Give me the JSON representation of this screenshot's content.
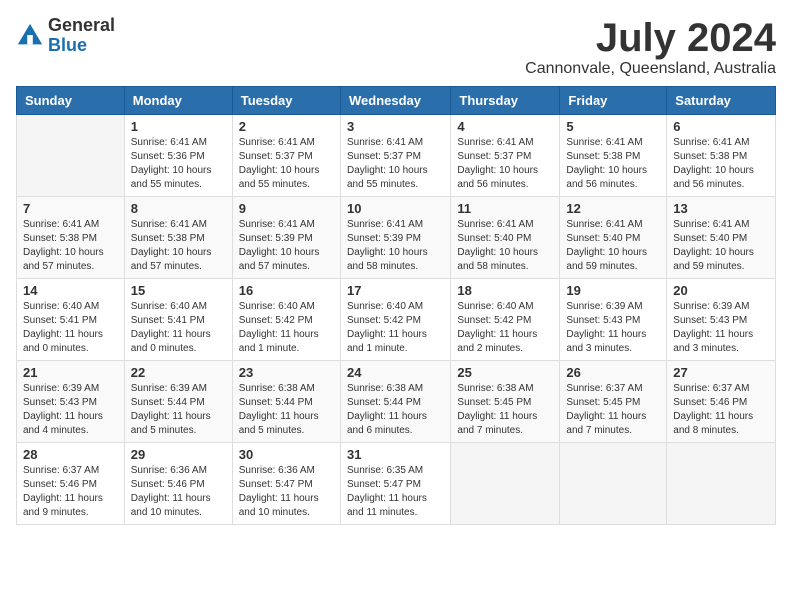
{
  "logo": {
    "general": "General",
    "blue": "Blue"
  },
  "title": "July 2024",
  "location": "Cannonvale, Queensland, Australia",
  "weekdays": [
    "Sunday",
    "Monday",
    "Tuesday",
    "Wednesday",
    "Thursday",
    "Friday",
    "Saturday"
  ],
  "weeks": [
    [
      {
        "day": "",
        "sunrise": "",
        "sunset": "",
        "daylight": ""
      },
      {
        "day": "1",
        "sunrise": "Sunrise: 6:41 AM",
        "sunset": "Sunset: 5:36 PM",
        "daylight": "Daylight: 10 hours and 55 minutes."
      },
      {
        "day": "2",
        "sunrise": "Sunrise: 6:41 AM",
        "sunset": "Sunset: 5:37 PM",
        "daylight": "Daylight: 10 hours and 55 minutes."
      },
      {
        "day": "3",
        "sunrise": "Sunrise: 6:41 AM",
        "sunset": "Sunset: 5:37 PM",
        "daylight": "Daylight: 10 hours and 55 minutes."
      },
      {
        "day": "4",
        "sunrise": "Sunrise: 6:41 AM",
        "sunset": "Sunset: 5:37 PM",
        "daylight": "Daylight: 10 hours and 56 minutes."
      },
      {
        "day": "5",
        "sunrise": "Sunrise: 6:41 AM",
        "sunset": "Sunset: 5:38 PM",
        "daylight": "Daylight: 10 hours and 56 minutes."
      },
      {
        "day": "6",
        "sunrise": "Sunrise: 6:41 AM",
        "sunset": "Sunset: 5:38 PM",
        "daylight": "Daylight: 10 hours and 56 minutes."
      }
    ],
    [
      {
        "day": "7",
        "sunrise": "Sunrise: 6:41 AM",
        "sunset": "Sunset: 5:38 PM",
        "daylight": "Daylight: 10 hours and 57 minutes."
      },
      {
        "day": "8",
        "sunrise": "Sunrise: 6:41 AM",
        "sunset": "Sunset: 5:38 PM",
        "daylight": "Daylight: 10 hours and 57 minutes."
      },
      {
        "day": "9",
        "sunrise": "Sunrise: 6:41 AM",
        "sunset": "Sunset: 5:39 PM",
        "daylight": "Daylight: 10 hours and 57 minutes."
      },
      {
        "day": "10",
        "sunrise": "Sunrise: 6:41 AM",
        "sunset": "Sunset: 5:39 PM",
        "daylight": "Daylight: 10 hours and 58 minutes."
      },
      {
        "day": "11",
        "sunrise": "Sunrise: 6:41 AM",
        "sunset": "Sunset: 5:40 PM",
        "daylight": "Daylight: 10 hours and 58 minutes."
      },
      {
        "day": "12",
        "sunrise": "Sunrise: 6:41 AM",
        "sunset": "Sunset: 5:40 PM",
        "daylight": "Daylight: 10 hours and 59 minutes."
      },
      {
        "day": "13",
        "sunrise": "Sunrise: 6:41 AM",
        "sunset": "Sunset: 5:40 PM",
        "daylight": "Daylight: 10 hours and 59 minutes."
      }
    ],
    [
      {
        "day": "14",
        "sunrise": "Sunrise: 6:40 AM",
        "sunset": "Sunset: 5:41 PM",
        "daylight": "Daylight: 11 hours and 0 minutes."
      },
      {
        "day": "15",
        "sunrise": "Sunrise: 6:40 AM",
        "sunset": "Sunset: 5:41 PM",
        "daylight": "Daylight: 11 hours and 0 minutes."
      },
      {
        "day": "16",
        "sunrise": "Sunrise: 6:40 AM",
        "sunset": "Sunset: 5:42 PM",
        "daylight": "Daylight: 11 hours and 1 minute."
      },
      {
        "day": "17",
        "sunrise": "Sunrise: 6:40 AM",
        "sunset": "Sunset: 5:42 PM",
        "daylight": "Daylight: 11 hours and 1 minute."
      },
      {
        "day": "18",
        "sunrise": "Sunrise: 6:40 AM",
        "sunset": "Sunset: 5:42 PM",
        "daylight": "Daylight: 11 hours and 2 minutes."
      },
      {
        "day": "19",
        "sunrise": "Sunrise: 6:39 AM",
        "sunset": "Sunset: 5:43 PM",
        "daylight": "Daylight: 11 hours and 3 minutes."
      },
      {
        "day": "20",
        "sunrise": "Sunrise: 6:39 AM",
        "sunset": "Sunset: 5:43 PM",
        "daylight": "Daylight: 11 hours and 3 minutes."
      }
    ],
    [
      {
        "day": "21",
        "sunrise": "Sunrise: 6:39 AM",
        "sunset": "Sunset: 5:43 PM",
        "daylight": "Daylight: 11 hours and 4 minutes."
      },
      {
        "day": "22",
        "sunrise": "Sunrise: 6:39 AM",
        "sunset": "Sunset: 5:44 PM",
        "daylight": "Daylight: 11 hours and 5 minutes."
      },
      {
        "day": "23",
        "sunrise": "Sunrise: 6:38 AM",
        "sunset": "Sunset: 5:44 PM",
        "daylight": "Daylight: 11 hours and 5 minutes."
      },
      {
        "day": "24",
        "sunrise": "Sunrise: 6:38 AM",
        "sunset": "Sunset: 5:44 PM",
        "daylight": "Daylight: 11 hours and 6 minutes."
      },
      {
        "day": "25",
        "sunrise": "Sunrise: 6:38 AM",
        "sunset": "Sunset: 5:45 PM",
        "daylight": "Daylight: 11 hours and 7 minutes."
      },
      {
        "day": "26",
        "sunrise": "Sunrise: 6:37 AM",
        "sunset": "Sunset: 5:45 PM",
        "daylight": "Daylight: 11 hours and 7 minutes."
      },
      {
        "day": "27",
        "sunrise": "Sunrise: 6:37 AM",
        "sunset": "Sunset: 5:46 PM",
        "daylight": "Daylight: 11 hours and 8 minutes."
      }
    ],
    [
      {
        "day": "28",
        "sunrise": "Sunrise: 6:37 AM",
        "sunset": "Sunset: 5:46 PM",
        "daylight": "Daylight: 11 hours and 9 minutes."
      },
      {
        "day": "29",
        "sunrise": "Sunrise: 6:36 AM",
        "sunset": "Sunset: 5:46 PM",
        "daylight": "Daylight: 11 hours and 10 minutes."
      },
      {
        "day": "30",
        "sunrise": "Sunrise: 6:36 AM",
        "sunset": "Sunset: 5:47 PM",
        "daylight": "Daylight: 11 hours and 10 minutes."
      },
      {
        "day": "31",
        "sunrise": "Sunrise: 6:35 AM",
        "sunset": "Sunset: 5:47 PM",
        "daylight": "Daylight: 11 hours and 11 minutes."
      },
      {
        "day": "",
        "sunrise": "",
        "sunset": "",
        "daylight": ""
      },
      {
        "day": "",
        "sunrise": "",
        "sunset": "",
        "daylight": ""
      },
      {
        "day": "",
        "sunrise": "",
        "sunset": "",
        "daylight": ""
      }
    ]
  ]
}
